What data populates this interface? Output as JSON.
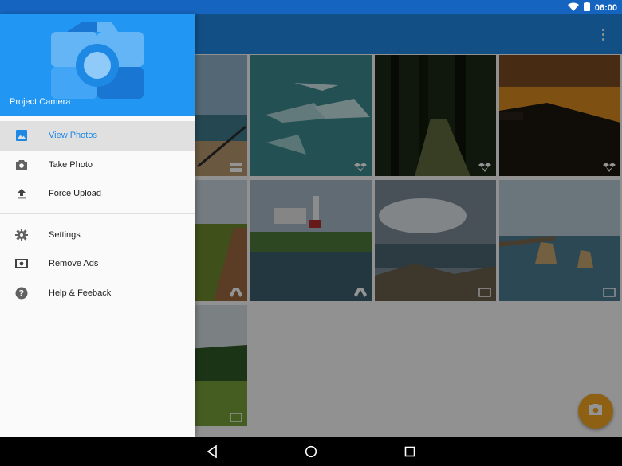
{
  "status_bar": {
    "time": "06:00",
    "icons": [
      "wifi-icon",
      "battery-icon"
    ]
  },
  "app_bar": {
    "overflow_icon": "more-vert-icon"
  },
  "drawer": {
    "title": "Project Camera",
    "logo_icon": "camera-logo-icon",
    "items": [
      {
        "label": "View Photos",
        "icon": "image-icon",
        "active": true
      },
      {
        "label": "Take Photo",
        "icon": "camera-icon",
        "active": false
      },
      {
        "label": "Force Upload",
        "icon": "upload-icon",
        "active": false
      }
    ],
    "secondary_items": [
      {
        "label": "Settings",
        "icon": "settings-icon"
      },
      {
        "label": "Remove Ads",
        "icon": "money-icon"
      },
      {
        "label": "Help & Feeback",
        "icon": "help-icon"
      }
    ]
  },
  "grid": {
    "photos": [
      {
        "scene": "beach",
        "badge": "server-icon"
      },
      {
        "scene": "stingrays",
        "badge": "dropbox-icon"
      },
      {
        "scene": "forest-path",
        "badge": "dropbox-icon"
      },
      {
        "scene": "sunset-coast",
        "badge": "dropbox-icon"
      },
      {
        "scene": "field-path",
        "badge": "drive-icon"
      },
      {
        "scene": "lighthouse",
        "badge": "drive-icon"
      },
      {
        "scene": "clouds-rocks",
        "badge": "device-icon"
      },
      {
        "scene": "sea-stacks",
        "badge": "device-icon"
      },
      {
        "scene": "hedge-lawn",
        "badge": "device-icon"
      }
    ]
  },
  "fab": {
    "icon": "camera-icon"
  },
  "nav_bar": {
    "buttons": [
      "back-icon",
      "home-icon",
      "recents-icon"
    ]
  },
  "colors": {
    "status_bar": "#1565c0",
    "app_bar": "#1e88e5",
    "drawer_header": "#2196f3",
    "accent_active": "#1e88e5",
    "fab": "#f5a623"
  }
}
